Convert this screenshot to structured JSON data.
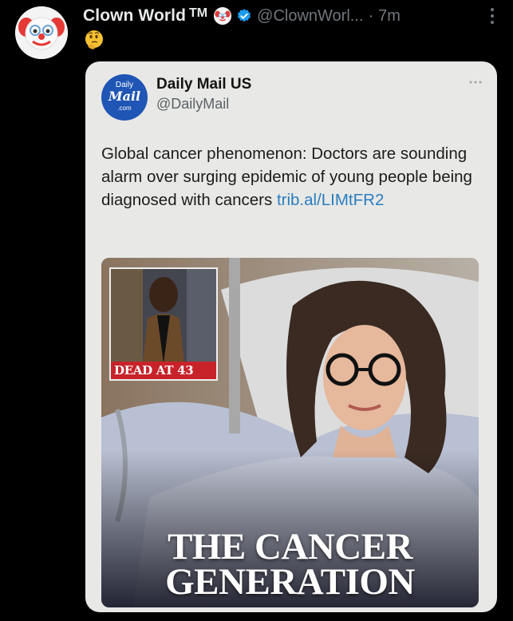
{
  "post": {
    "author_name": "Clown World",
    "tm": "TM",
    "handle": "@ClownWorl...",
    "separator": "·",
    "time": "7m",
    "text_emoji": "thinking-face-emoji"
  },
  "quoted": {
    "logo": {
      "line1": "Daily",
      "line2": "Mail",
      "line3": ".com"
    },
    "name": "Daily Mail US",
    "handle": "@DailyMail",
    "text": "Global cancer phenomenon: Doctors are sounding alarm over surging epidemic of young people being diagnosed with cancers ",
    "link": "trib.al/LIMtFR2",
    "image": {
      "inset_label": "DEAD AT 43",
      "headline_line1": "THE CANCER",
      "headline_line2": "GENERATION"
    }
  },
  "colors": {
    "background": "#000000",
    "card": "#e8e8e6",
    "link": "#2a7ec0",
    "verified": "#1d9bf0",
    "dead_label": "#c8232b",
    "dm_blue": "#1f55b4"
  }
}
